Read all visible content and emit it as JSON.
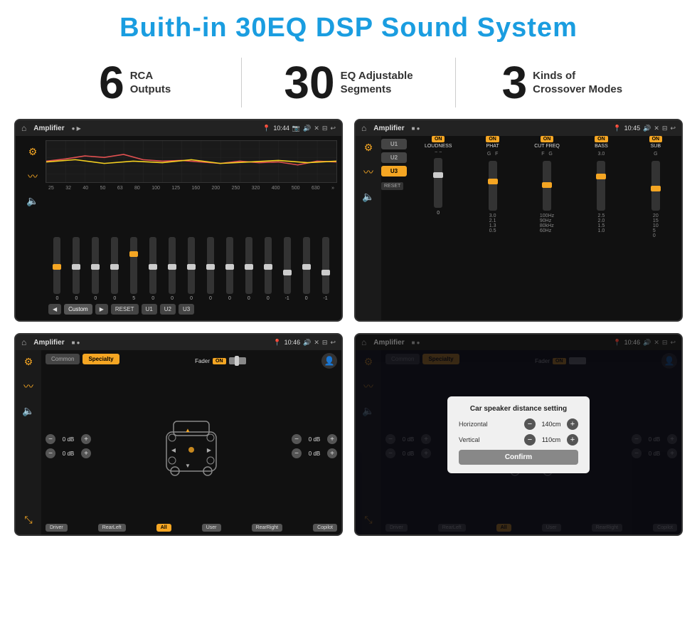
{
  "page": {
    "title": "Buith-in 30EQ DSP Sound System"
  },
  "stats": [
    {
      "number": "6",
      "label": "RCA\nOutputs"
    },
    {
      "number": "30",
      "label": "EQ Adjustable\nSegments"
    },
    {
      "number": "3",
      "label": "Kinds of\nCrossover Modes"
    }
  ],
  "screens": [
    {
      "id": "eq-screen",
      "status_bar": {
        "title": "Amplifier",
        "time": "10:44"
      }
    },
    {
      "id": "crossover-screen",
      "status_bar": {
        "title": "Amplifier",
        "time": "10:45"
      }
    },
    {
      "id": "speaker-screen",
      "status_bar": {
        "title": "Amplifier",
        "time": "10:46"
      }
    },
    {
      "id": "dialog-screen",
      "status_bar": {
        "title": "Amplifier",
        "time": "10:46"
      },
      "dialog": {
        "title": "Car speaker distance setting",
        "horizontal_label": "Horizontal",
        "horizontal_value": "140cm",
        "vertical_label": "Vertical",
        "vertical_value": "110cm",
        "confirm_label": "Confirm"
      }
    }
  ],
  "eq": {
    "frequencies": [
      "25",
      "32",
      "40",
      "50",
      "63",
      "80",
      "100",
      "125",
      "160",
      "200",
      "250",
      "320",
      "400",
      "500",
      "630"
    ],
    "values": [
      "0",
      "0",
      "0",
      "0",
      "5",
      "0",
      "0",
      "0",
      "0",
      "0",
      "0",
      "0",
      "-1",
      "0",
      "-1"
    ],
    "preset": "Custom",
    "buttons": [
      "RESET",
      "U1",
      "U2",
      "U3"
    ]
  },
  "crossover": {
    "presets": [
      "U1",
      "U2",
      "U3"
    ],
    "channels": [
      {
        "name": "LOUDNESS",
        "on": true
      },
      {
        "name": "PHAT",
        "on": true
      },
      {
        "name": "CUT FREQ",
        "on": true
      },
      {
        "name": "BASS",
        "on": true
      },
      {
        "name": "SUB",
        "on": true
      }
    ],
    "reset_label": "RESET"
  },
  "speaker": {
    "tabs": [
      "Common",
      "Specialty"
    ],
    "fader_label": "Fader",
    "fader_on": "ON",
    "db_values": [
      "0 dB",
      "0 dB",
      "0 dB",
      "0 dB"
    ],
    "buttons": [
      "Driver",
      "RearLeft",
      "All",
      "User",
      "RearRight",
      "Copilot"
    ]
  }
}
